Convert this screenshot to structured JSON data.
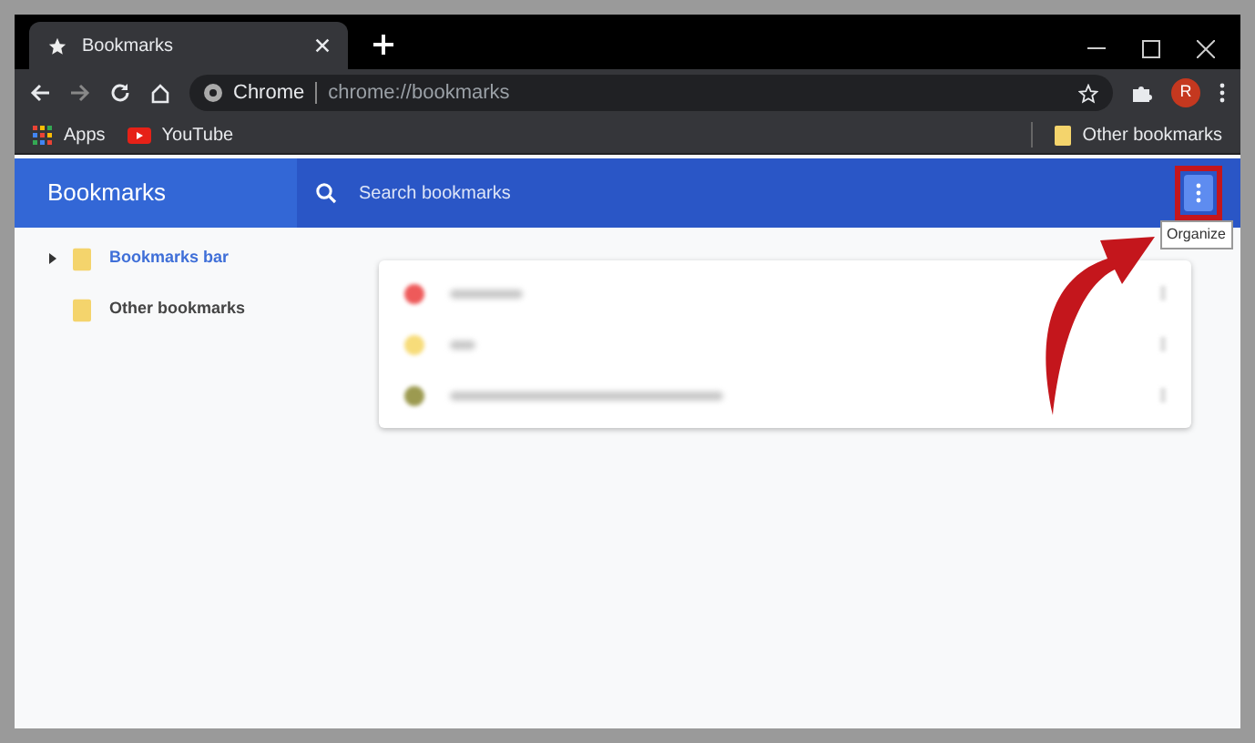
{
  "tab": {
    "title": "Bookmarks"
  },
  "address": {
    "site": "Chrome",
    "url": "chrome://bookmarks"
  },
  "profile": {
    "initial": "R"
  },
  "bookmarks_bar": [
    {
      "label": "Apps",
      "kind": "apps"
    },
    {
      "label": "YouTube",
      "kind": "youtube"
    }
  ],
  "other_bookmarks": "Other bookmarks",
  "header": {
    "title": "Bookmarks",
    "search_placeholder": "Search bookmarks",
    "menu_tooltip": "Organize"
  },
  "sidebar": {
    "items": [
      {
        "label": "Bookmarks bar",
        "selected": true,
        "expanded": false
      },
      {
        "label": "Other bookmarks",
        "selected": false
      }
    ]
  },
  "list": {
    "items": [
      {
        "color": "#ee5a5a"
      },
      {
        "color": "#f7dc7a"
      },
      {
        "color": "#9c9a50"
      }
    ]
  }
}
